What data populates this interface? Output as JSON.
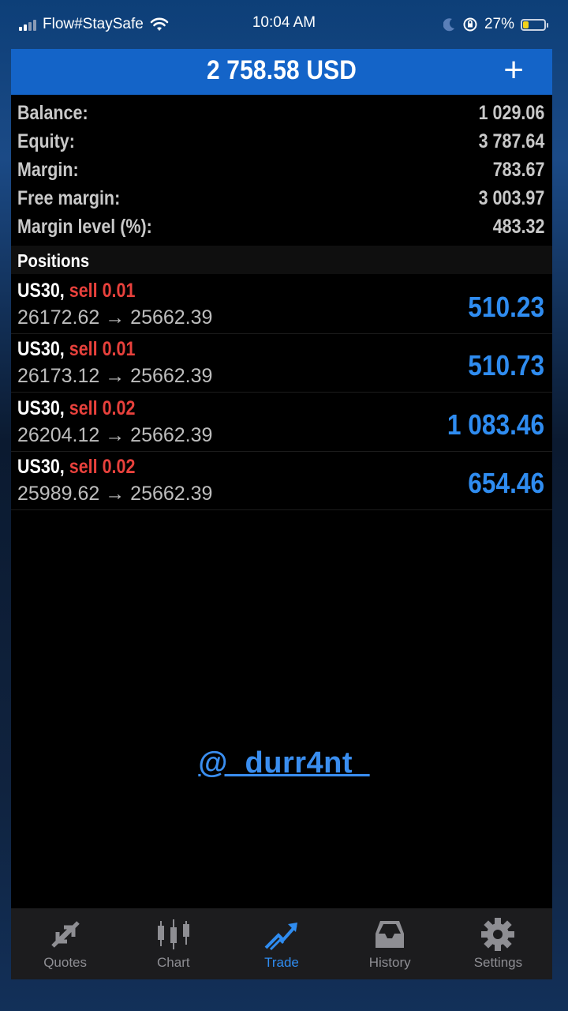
{
  "status_bar": {
    "carrier": "Flow#StaySafe",
    "time": "10:04 AM",
    "battery": "27%",
    "battery_level": 0.27
  },
  "header": {
    "title": "2 758.58 USD",
    "add_label": "+"
  },
  "summary": [
    {
      "label": "Balance:",
      "value": "1 029.06"
    },
    {
      "label": "Equity:",
      "value": "3 787.64"
    },
    {
      "label": "Margin:",
      "value": "783.67"
    },
    {
      "label": "Free margin:",
      "value": "3 003.97"
    },
    {
      "label": "Margin level (%):",
      "value": "483.32"
    }
  ],
  "positions": {
    "title": "Positions",
    "items": [
      {
        "symbol": "US30,",
        "side": "sell 0.01",
        "prices": "26172.62 → 25662.39",
        "profit": "510.23"
      },
      {
        "symbol": "US30,",
        "side": "sell 0.01",
        "prices": "26173.12 → 25662.39",
        "profit": "510.73"
      },
      {
        "symbol": "US30,",
        "side": "sell 0.02",
        "prices": "26204.12 → 25662.39",
        "profit": "1 083.46"
      },
      {
        "symbol": "US30,",
        "side": "sell 0.02",
        "prices": "25989.62 → 25662.39",
        "profit": "654.46"
      }
    ]
  },
  "watermark": "@_durr4nt_",
  "tabs": [
    {
      "label": "Quotes",
      "icon": "quotes-arrows-icon",
      "active": false
    },
    {
      "label": "Chart",
      "icon": "candlestick-chart-icon",
      "active": false
    },
    {
      "label": "Trade",
      "icon": "trade-trend-icon",
      "active": true
    },
    {
      "label": "History",
      "icon": "inbox-tray-icon",
      "active": false
    },
    {
      "label": "Settings",
      "icon": "gear-icon",
      "active": false
    }
  ],
  "colors": {
    "header_bg": "#1464c8",
    "profit": "#2f8cf0",
    "sell": "#e8413c",
    "tab_active": "#2f8cf0",
    "tab_inactive": "#8e8e93"
  }
}
